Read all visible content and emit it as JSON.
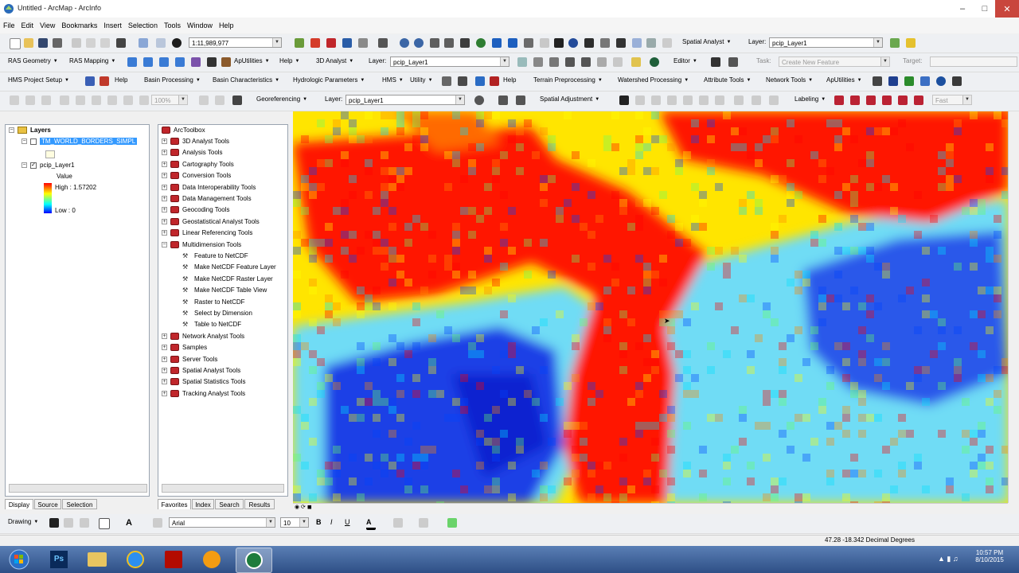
{
  "window": {
    "title": "Untitled - ArcMap - ArcInfo"
  },
  "menu": [
    "File",
    "Edit",
    "View",
    "Bookmarks",
    "Insert",
    "Selection",
    "Tools",
    "Window",
    "Help"
  ],
  "toolbar1": {
    "scale": "1:11,989,977",
    "spatial_analyst": "Spatial Analyst",
    "layer_label": "Layer:",
    "layer": "pcip_Layer1"
  },
  "toolbar2": {
    "ras_geometry": "RAS Geometry",
    "ras_mapping": "RAS Mapping",
    "aputilities": "ApUtilities",
    "help": "Help",
    "analyst_3d": "3D Analyst",
    "layer_label": "Layer:",
    "layer": "pcip_Layer1",
    "editor": "Editor",
    "task_label": "Task:",
    "task": "Create New Feature",
    "target_label": "Target:"
  },
  "toolbar3": {
    "hms_setup": "HMS Project Setup",
    "help": "Help",
    "basin_processing": "Basin Processing",
    "basin_char": "Basin Characteristics",
    "hydro_params": "Hydrologic Parameters",
    "hms": "HMS",
    "utility": "Utility",
    "help2": "Help",
    "terrain": "Terrain Preprocessing",
    "watershed": "Watershed Processing",
    "attribute": "Attribute Tools",
    "network": "Network Tools",
    "aputilities": "ApUtilities"
  },
  "toolbar4": {
    "zoom": "100%",
    "georeferencing": "Georeferencing",
    "layer_label": "Layer:",
    "layer": "pcip_Layer1",
    "spatial_adjustment": "Spatial Adjustment",
    "labeling": "Labeling",
    "fast": "Fast"
  },
  "toc": {
    "root": "Layers",
    "layer1": "TM_WORLD_BORDERS_SIMPL",
    "layer2": "pcip_Layer1",
    "value_label": "Value",
    "high": "High : 1.57202",
    "low": "Low : 0",
    "tabs": [
      "Display",
      "Source",
      "Selection"
    ]
  },
  "toolbox": {
    "root": "ArcToolbox",
    "items": [
      "3D Analyst Tools",
      "Analysis Tools",
      "Cartography Tools",
      "Conversion Tools",
      "Data Interoperability Tools",
      "Data Management Tools",
      "Geocoding Tools",
      "Geostatistical Analyst Tools",
      "Linear Referencing Tools",
      "Multidimension Tools"
    ],
    "sub": [
      "Feature to NetCDF",
      "Make NetCDF Feature Layer",
      "Make NetCDF Raster Layer",
      "Make NetCDF Table View",
      "Raster to NetCDF",
      "Select by Dimension",
      "Table to NetCDF"
    ],
    "items2": [
      "Network Analyst Tools",
      "Samples",
      "Server Tools",
      "Spatial Analyst Tools",
      "Spatial Statistics Tools",
      "Tracking Analyst Tools"
    ],
    "tabs": [
      "Favorites",
      "Index",
      "Search",
      "Results"
    ]
  },
  "drawing": {
    "label": "Drawing",
    "font": "Arial",
    "size": "10"
  },
  "status": {
    "coords": "47.28  -18.342 Decimal Degrees"
  },
  "clock": {
    "time": "10:57 PM",
    "date": "8/10/2015"
  },
  "colors": {
    "high": "#ff0000",
    "mid": "#ffff00",
    "low": "#0000ff",
    "accent": "#3399ff"
  }
}
